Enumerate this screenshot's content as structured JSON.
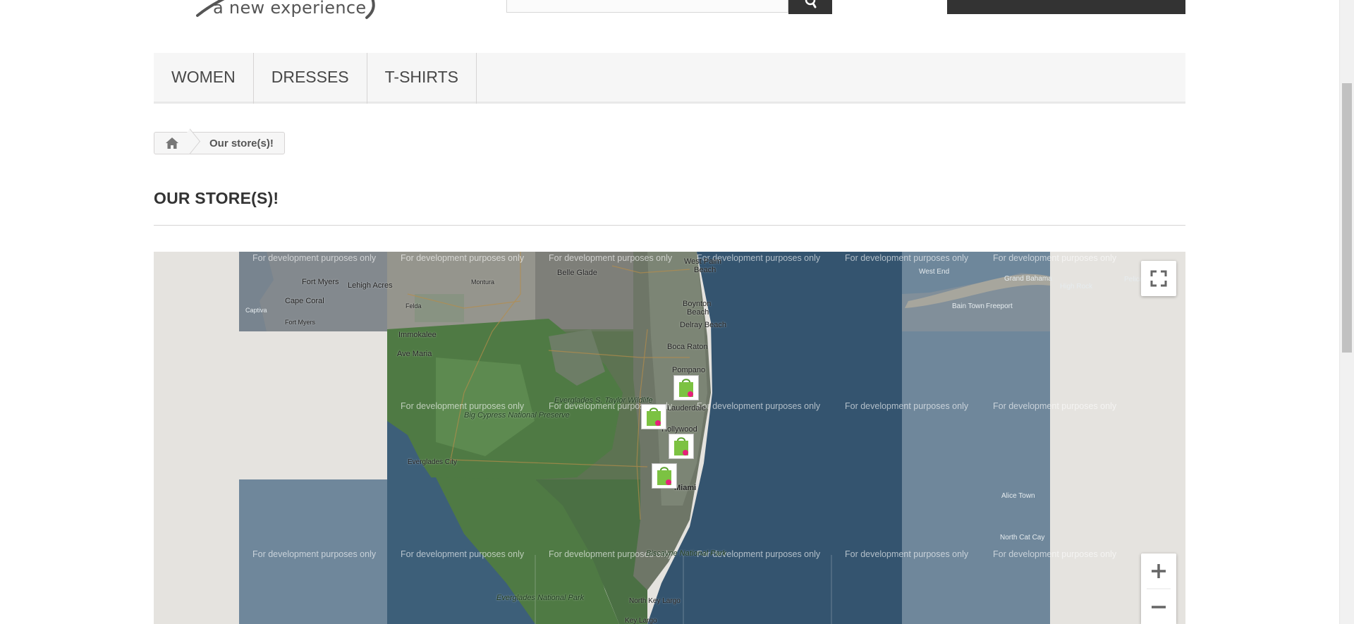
{
  "header": {
    "logo_tagline": "a new experience",
    "search": {
      "placeholder": ""
    }
  },
  "menu": {
    "items": [
      {
        "label": "WOMEN"
      },
      {
        "label": "DRESSES"
      },
      {
        "label": "T-SHIRTS"
      }
    ]
  },
  "breadcrumb": {
    "home_icon": "home-icon",
    "current": "Our store(s)!"
  },
  "page": {
    "heading": "OUR STORE(S)!"
  },
  "map": {
    "watermark": "For development purposes only",
    "labels": {
      "cape_coral": "Cape Coral",
      "fort_myers": "Fort Myers",
      "lehigh_acres": "Lehigh Acres",
      "fort_myers_beach": "Fort Myers",
      "captiva": "Captiva",
      "montura": "Montura",
      "felda": "Felda",
      "immokalee": "Immokalee",
      "ave_maria": "Ave Maria",
      "belle_glade": "Belle Glade",
      "west_palm": "West Palm",
      "beach": "Beach",
      "boynton": "Boynton",
      "boynton_beach": "Beach",
      "delray_beach": "Delray Beach",
      "boca_raton": "Boca Raton",
      "pompano": "Pompano",
      "fort_lauderdale": "Lauderdale",
      "hollywood": "Hollywood",
      "miami": "Miami",
      "everglades_city": "Everglades City",
      "big_cypress": "Big Cypress National Preserve",
      "everglades_wildlife": "Everglades S. Taylor Wildlife",
      "biscayne": "Biscayne National Park",
      "everglades_np": "Everglades National Park",
      "north_key_largo": "North Key Largo",
      "key_largo": "Key Largo",
      "west_end": "West End",
      "grand_bahama": "Grand Bahama",
      "high_rock": "High Rock",
      "pelican": "Pelican P",
      "bain_town": "Bain Town",
      "freeport": "Freeport",
      "alice_town": "Alice Town",
      "north_cat_cay": "North Cat Cay"
    },
    "markers": [
      {
        "name": "store-marker"
      },
      {
        "name": "store-marker"
      },
      {
        "name": "store-marker"
      },
      {
        "name": "store-marker"
      }
    ],
    "controls": {
      "fullscreen_icon": "fullscreen-icon",
      "zoom_in_icon": "plus-icon",
      "zoom_out_icon": "minus-icon"
    }
  },
  "colors": {
    "menu_bg": "#f6f6f6",
    "dark_button": "#333333",
    "ocean_dark": "#34546f",
    "ocean_light": "#6f879b",
    "land_green": "#4f7a44",
    "marker_green": "#7cc242",
    "marker_pink": "#e6207a"
  }
}
